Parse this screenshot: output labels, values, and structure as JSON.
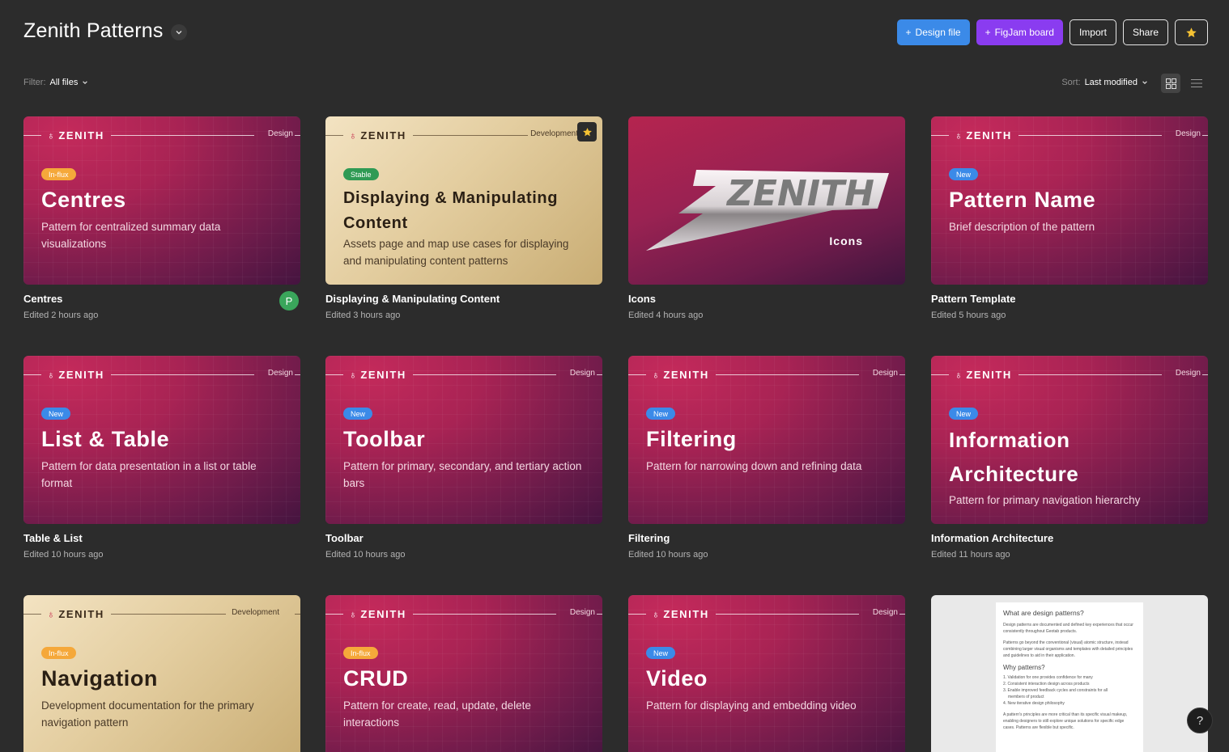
{
  "header": {
    "title": "Zenith Patterns",
    "buttons": {
      "design_file": "Design file",
      "figjam_board": "FigJam board",
      "import": "Import",
      "share": "Share"
    }
  },
  "filters": {
    "filter_label": "Filter:",
    "filter_value": "All files",
    "sort_label": "Sort:",
    "sort_value": "Last modified"
  },
  "colors": {
    "background": "#2c2c2c",
    "accent_blue": "#3b8ae8",
    "accent_purple": "#8a3cf0",
    "status_new": "#3b8ae8",
    "status_influx": "#f5a83a",
    "status_stable": "#2f9a54",
    "star": "#f5c233"
  },
  "brand": "ZENITH",
  "files": [
    {
      "name": "Centres",
      "edited": "Edited 2 hours ago",
      "type_label": "Design",
      "status": "In-flux",
      "title": "Centres",
      "desc": "Pattern for centralized summary data visualizations",
      "avatar": "P"
    },
    {
      "name": "Displaying & Manipulating Content",
      "edited": "Edited 3 hours ago",
      "type_label": "Development",
      "status": "Stable",
      "title": "Displaying & Manipulating Content",
      "desc": "Assets page and map use cases for displaying and manipulating content patterns",
      "favorite": true
    },
    {
      "name": "Icons",
      "edited": "Edited 4 hours ago",
      "logo_text": "ZENITH",
      "label": "Icons"
    },
    {
      "name": "Pattern Template",
      "edited": "Edited 5 hours ago",
      "type_label": "Design",
      "status": "New",
      "title": "Pattern Name",
      "desc": "Brief description of the pattern"
    },
    {
      "name": "Table & List",
      "edited": "Edited 10 hours ago",
      "type_label": "Design",
      "status": "New",
      "title": "List & Table",
      "desc": "Pattern for data presentation in a list or table format"
    },
    {
      "name": "Toolbar",
      "edited": "Edited 10 hours ago",
      "type_label": "Design",
      "status": "New",
      "title": "Toolbar",
      "desc": "Pattern for primary, secondary, and tertiary action bars"
    },
    {
      "name": "Filtering",
      "edited": "Edited 10 hours ago",
      "type_label": "Design",
      "status": "New",
      "title": "Filtering",
      "desc": "Pattern for narrowing down and refining data"
    },
    {
      "name": "Information Architecture",
      "edited": "Edited 11 hours ago",
      "type_label": "Design",
      "status": "New",
      "title": "Information Architecture",
      "desc": "Pattern for primary navigation hierarchy"
    },
    {
      "type_label": "Development",
      "status": "In-flux",
      "title": "Navigation",
      "desc": "Development documentation for the primary navigation pattern"
    },
    {
      "type_label": "Design",
      "status": "In-flux",
      "title": "CRUD",
      "desc": "Pattern for create, read, update, delete interactions"
    },
    {
      "type_label": "Design",
      "status": "New",
      "title": "Video",
      "desc": "Pattern for displaying and embedding video"
    },
    {
      "doc": {
        "heading": "What are design patterns?",
        "p1": "Design patterns are documented and defined key experiences that occur consistently throughout Geotab products.",
        "p2": "Patterns go beyond the conventional (visual) atomic structure, instead combining larger visual organisms and templates with detailed principles and guidelines to aid in their application.",
        "heading2": "Why patterns?",
        "li1": "1. Validation for one provides confidence for many",
        "li2": "2. Consistent interaction design across products",
        "li3": "3. Enable improved feedback cycles and constraints for all",
        "li3b": "members of product",
        "li4": "4. New iterative design philosophy",
        "p3": "A pattern's principles are more critical than its specific visual makeup, enabling designers to still explore unique solutions for specific edge cases. Patterns are flexible but specific."
      }
    }
  ],
  "help_label": "?"
}
